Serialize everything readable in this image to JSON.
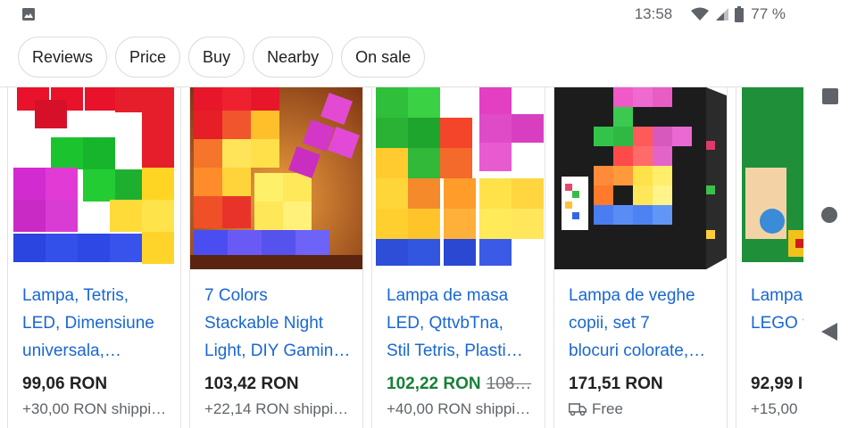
{
  "status_bar": {
    "time": "13:58",
    "battery": "77 %",
    "icons": [
      "gallery-icon",
      "wifi-icon",
      "signal-icon",
      "battery-icon"
    ]
  },
  "chips": [
    "Reviews",
    "Price",
    "Buy",
    "Nearby",
    "On sale"
  ],
  "products": [
    {
      "title_lines": [
        "Lampa, Tetris,",
        "LED, Dimensiune",
        "universala,…"
      ],
      "price": "99,06 RON",
      "old_price": "",
      "shipping": "+30,00 RON shippi…",
      "free_shipping_icon": false
    },
    {
      "title_lines": [
        "7 Colors",
        "Stackable Night",
        "Light, DIY Gamin…"
      ],
      "price": "103,42 RON",
      "old_price": "",
      "shipping": "+22,14 RON shippi…",
      "free_shipping_icon": false
    },
    {
      "title_lines": [
        "Lampa de masa",
        "LED, QttvbTna,",
        "Stil Tetris, Plasti…"
      ],
      "price": "102,22 RON",
      "old_price": "108…",
      "shipping": "+40,00 RON shippi…",
      "free_shipping_icon": false,
      "on_sale": true
    },
    {
      "title_lines": [
        "Lampa de veghe",
        "copii, set 7",
        "blocuri colorate,…"
      ],
      "price": "171,51 RON",
      "old_price": "",
      "shipping": "Free",
      "free_shipping_icon": true
    },
    {
      "title_lines": [
        "Lampa",
        "LEGO v"
      ],
      "price": "92,99 I",
      "old_price": "",
      "shipping": "+15,00",
      "free_shipping_icon": false
    }
  ],
  "nav": {
    "icons": [
      "recent-apps-icon",
      "home-icon",
      "back-icon"
    ]
  },
  "colors": {
    "link": "#1967d2",
    "sale_price": "#188038",
    "muted": "#5f6368"
  }
}
